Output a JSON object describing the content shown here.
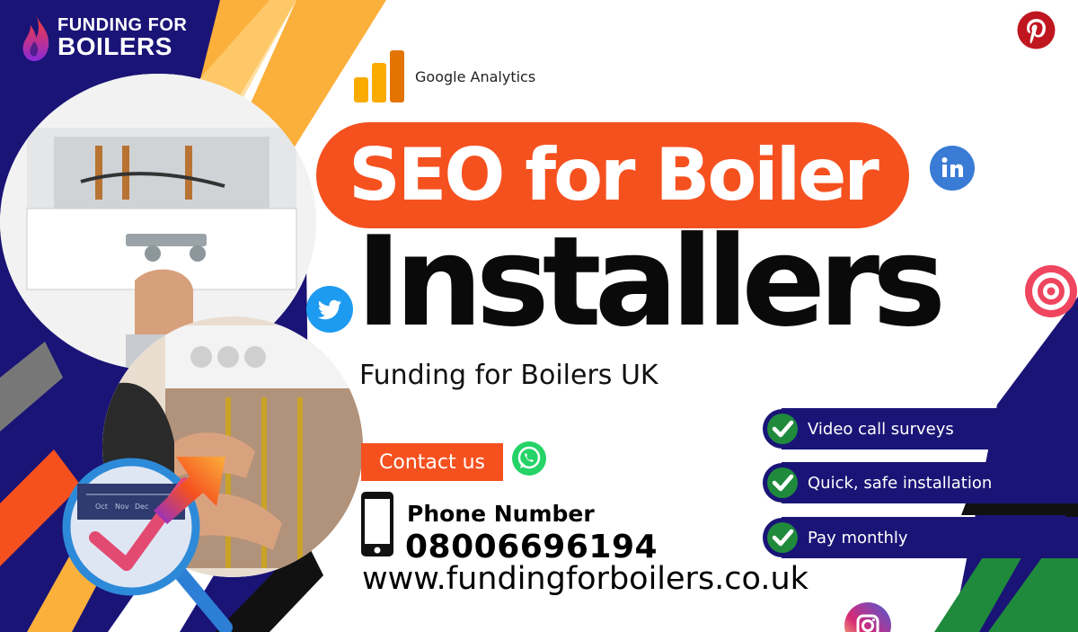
{
  "brand": {
    "line1": "FUNDING FOR",
    "line2": "BOILERS"
  },
  "analytics_label": "Google Analytics",
  "headline": {
    "line1": "SEO for Boiler",
    "line2": "Installers"
  },
  "subtitle": "Funding for Boilers UK",
  "contact_label": "Contact us",
  "phone": {
    "label": "Phone Number",
    "number": "08006696194"
  },
  "website": "www.fundingforboilers.co.uk",
  "features": [
    {
      "label": "Video call surveys"
    },
    {
      "label": "Quick, safe installation"
    },
    {
      "label": "Pay monthly"
    }
  ],
  "magnifier_labels": [
    "Oct",
    "Nov",
    "Dec"
  ],
  "colors": {
    "navy": "#1a1477",
    "orange": "#f5511f",
    "yellow": "#fbb03b",
    "green": "#1f8a3c",
    "white": "#ffffff"
  },
  "social_icons": [
    "pinterest-icon",
    "linkedin-icon",
    "twitter-icon",
    "target-icon",
    "whatsapp-icon",
    "instagram-icon"
  ]
}
